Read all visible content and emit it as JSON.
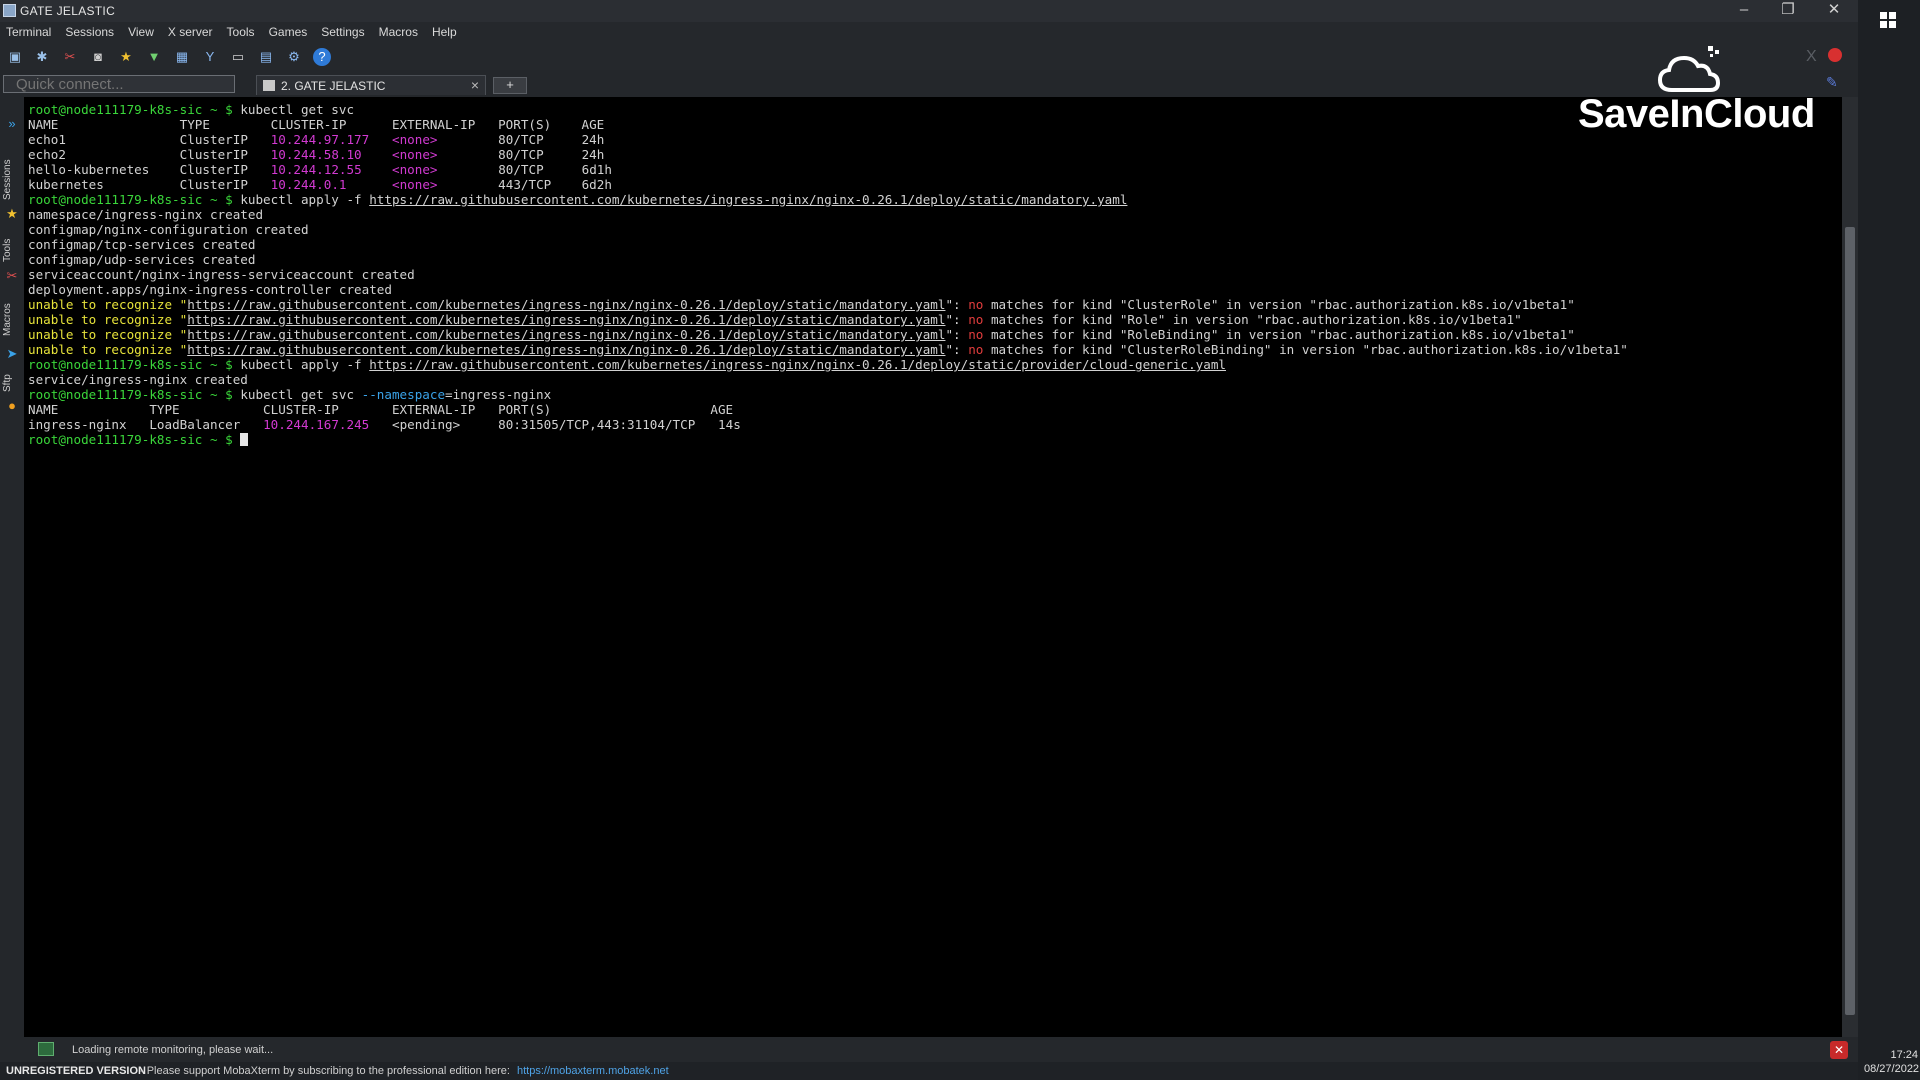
{
  "window": {
    "title": "GATE JELASTIC",
    "controls": {
      "minimize": "–",
      "restore": "❐",
      "close": "✕"
    }
  },
  "menu": [
    "Terminal",
    "Sessions",
    "View",
    "X server",
    "Tools",
    "Games",
    "Settings",
    "Macros",
    "Help"
  ],
  "toolbar": {
    "icons": [
      "session-icon",
      "servers-icon",
      "tools-icon",
      "games-icon",
      "sessions-star-icon",
      "view-icon",
      "split-icon",
      "multiexec-icon",
      "tunneling-icon",
      "packages-icon",
      "settings-icon",
      "help-icon"
    ]
  },
  "quick_connect": {
    "placeholder": "Quick connect..."
  },
  "tabs": [
    {
      "label": "2. GATE JELASTIC",
      "close": "×"
    }
  ],
  "new_tab": "+",
  "sidebar": {
    "labels": [
      "Sessions",
      "Tools",
      "Macros",
      "Sftp"
    ]
  },
  "logo": {
    "text": "SaveInCloud"
  },
  "terminal": {
    "prompt": "root@node111179-k8s-sic ~ $",
    "cmd1": "kubectl get svc",
    "svc_header": "NAME                TYPE        CLUSTER-IP      EXTERNAL-IP   PORT(S)    AGE",
    "svc_rows": [
      {
        "name": "echo1",
        "type": "ClusterIP",
        "ip": "10.244.97.177",
        "ext": "<none>",
        "ports": "80/TCP",
        "age": "24h"
      },
      {
        "name": "echo2",
        "type": "ClusterIP",
        "ip": "10.244.58.10",
        "ext": "<none>",
        "ports": "80/TCP",
        "age": "24h"
      },
      {
        "name": "hello-kubernetes",
        "type": "ClusterIP",
        "ip": "10.244.12.55",
        "ext": "<none>",
        "ports": "80/TCP",
        "age": "6d1h"
      },
      {
        "name": "kubernetes",
        "type": "ClusterIP",
        "ip": "10.244.0.1",
        "ext": "<none>",
        "ports": "443/TCP",
        "age": "6d2h"
      }
    ],
    "cmd2_prefix": "kubectl apply -f ",
    "cmd2_url": "https://raw.githubusercontent.com/kubernetes/ingress-nginx/nginx-0.26.1/deploy/static/mandatory.yaml",
    "created": [
      "namespace/ingress-nginx created",
      "configmap/nginx-configuration created",
      "configmap/tcp-services created",
      "configmap/udp-services created",
      "serviceaccount/nginx-ingress-serviceaccount created",
      "deployment.apps/nginx-ingress-controller created"
    ],
    "unable_prefix": "unable to recognize \"",
    "unable_url": "https://raw.githubusercontent.com/kubernetes/ingress-nginx/nginx-0.26.1/deploy/static/mandatory.yaml",
    "no_word": "no",
    "unable_rest": [
      " matches for kind \"ClusterRole\" in version \"rbac.authorization.k8s.io/v1beta1\"",
      " matches for kind \"Role\" in version \"rbac.authorization.k8s.io/v1beta1\"",
      " matches for kind \"RoleBinding\" in version \"rbac.authorization.k8s.io/v1beta1\"",
      " matches for kind \"ClusterRoleBinding\" in version \"rbac.authorization.k8s.io/v1beta1\""
    ],
    "cmd3_url": "https://raw.githubusercontent.com/kubernetes/ingress-nginx/nginx-0.26.1/deploy/static/provider/cloud-generic.yaml",
    "service_created": "service/ingress-nginx created",
    "cmd4_prefix": "kubectl get svc ",
    "cmd4_flag": "--namespace",
    "cmd4_rest": "=ingress-nginx",
    "ing_header": "NAME            TYPE           CLUSTER-IP       EXTERNAL-IP   PORT(S)                     AGE",
    "ing_row": {
      "name": "ingress-nginx",
      "type": "LoadBalancer",
      "ip": "10.244.167.245",
      "ext": "<pending>",
      "ports": "80:31505/TCP,443:31104/TCP",
      "age": "14s"
    }
  },
  "status": {
    "text": "Loading remote monitoring, please wait..."
  },
  "footer": {
    "unregistered": "UNREGISTERED VERSION",
    "support": "-  Please support MobaXterm by subscribing to the professional edition here:",
    "link": "https://mobaxterm.mobatek.net"
  },
  "taskbar": {
    "time": "17:24",
    "date": "08/27/2022"
  }
}
